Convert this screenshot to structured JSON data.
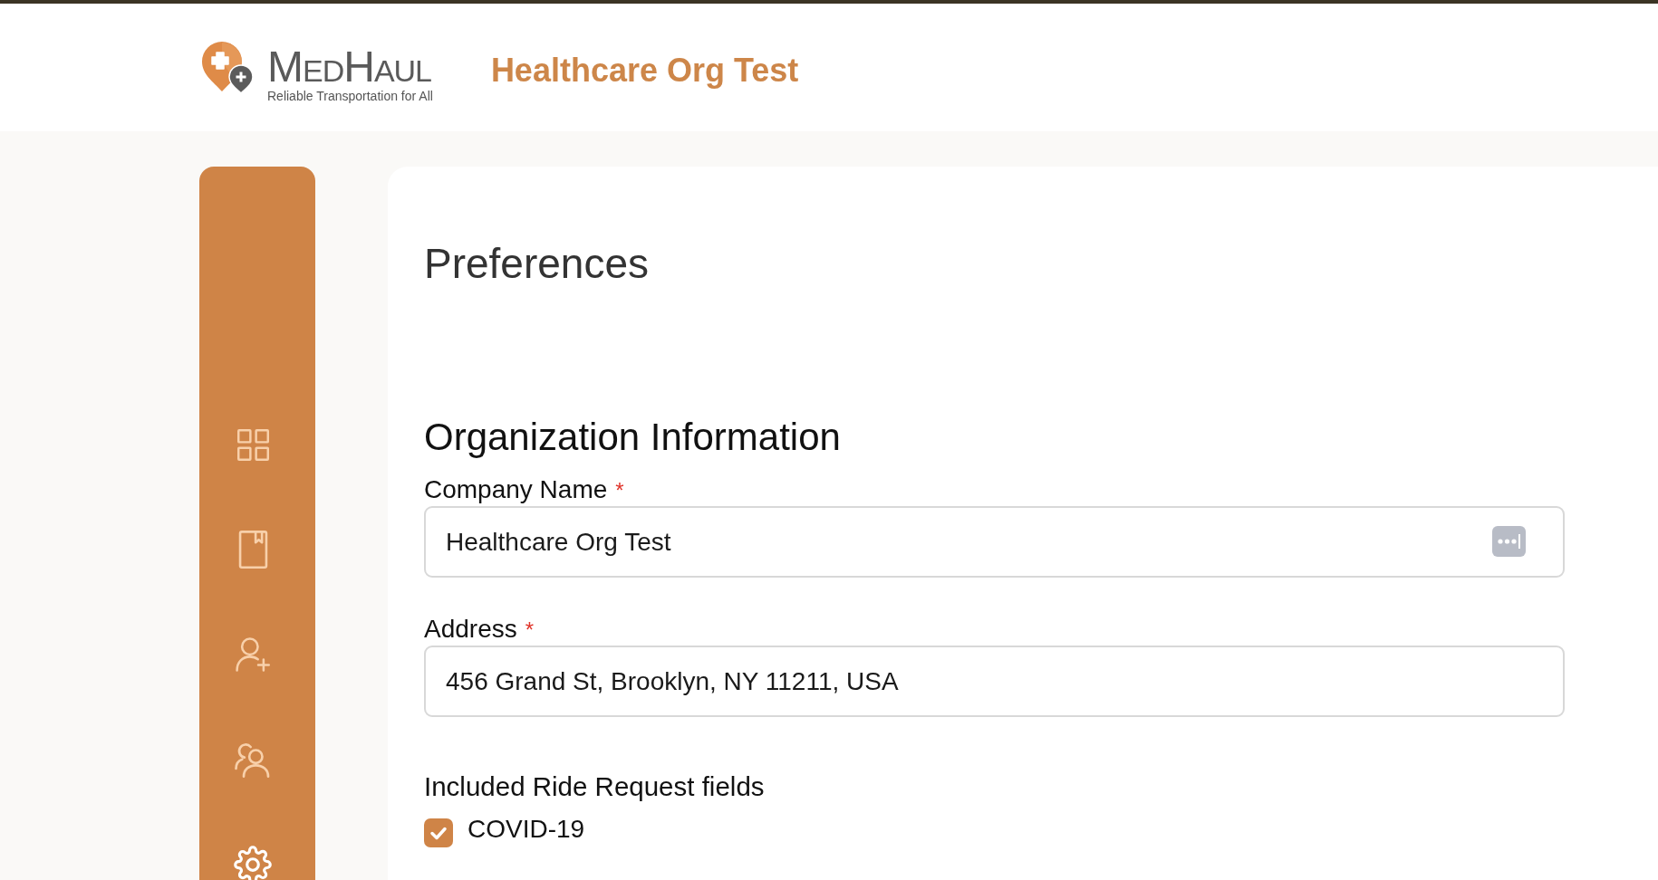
{
  "top_bar": {
    "logo": {
      "name": "MedHaul",
      "tagline": "Reliable Transportation for All"
    },
    "organization": "Healthcare Org Test"
  },
  "sidebar": {
    "items": [
      {
        "kind": "grid",
        "selected": false
      },
      {
        "kind": "book",
        "selected": false
      },
      {
        "kind": "user-add",
        "selected": false
      },
      {
        "kind": "users",
        "selected": false
      },
      {
        "kind": "gear",
        "selected": true
      }
    ]
  },
  "page": {
    "title": "Preferences",
    "section_title": "Organization Information",
    "fields": [
      {
        "label": "Company Name",
        "required_mark": "*",
        "value": "Healthcare Org Test",
        "kind": "autofill"
      },
      {
        "label": "Address",
        "required_mark": "*",
        "value": "456 Grand St, Brooklyn, NY 11211, USA",
        "kind": "plain"
      }
    ],
    "ride_request": {
      "title": "Included Ride Request fields",
      "options": [
        {
          "label": "COVID-19",
          "checked": true
        }
      ]
    }
  }
}
